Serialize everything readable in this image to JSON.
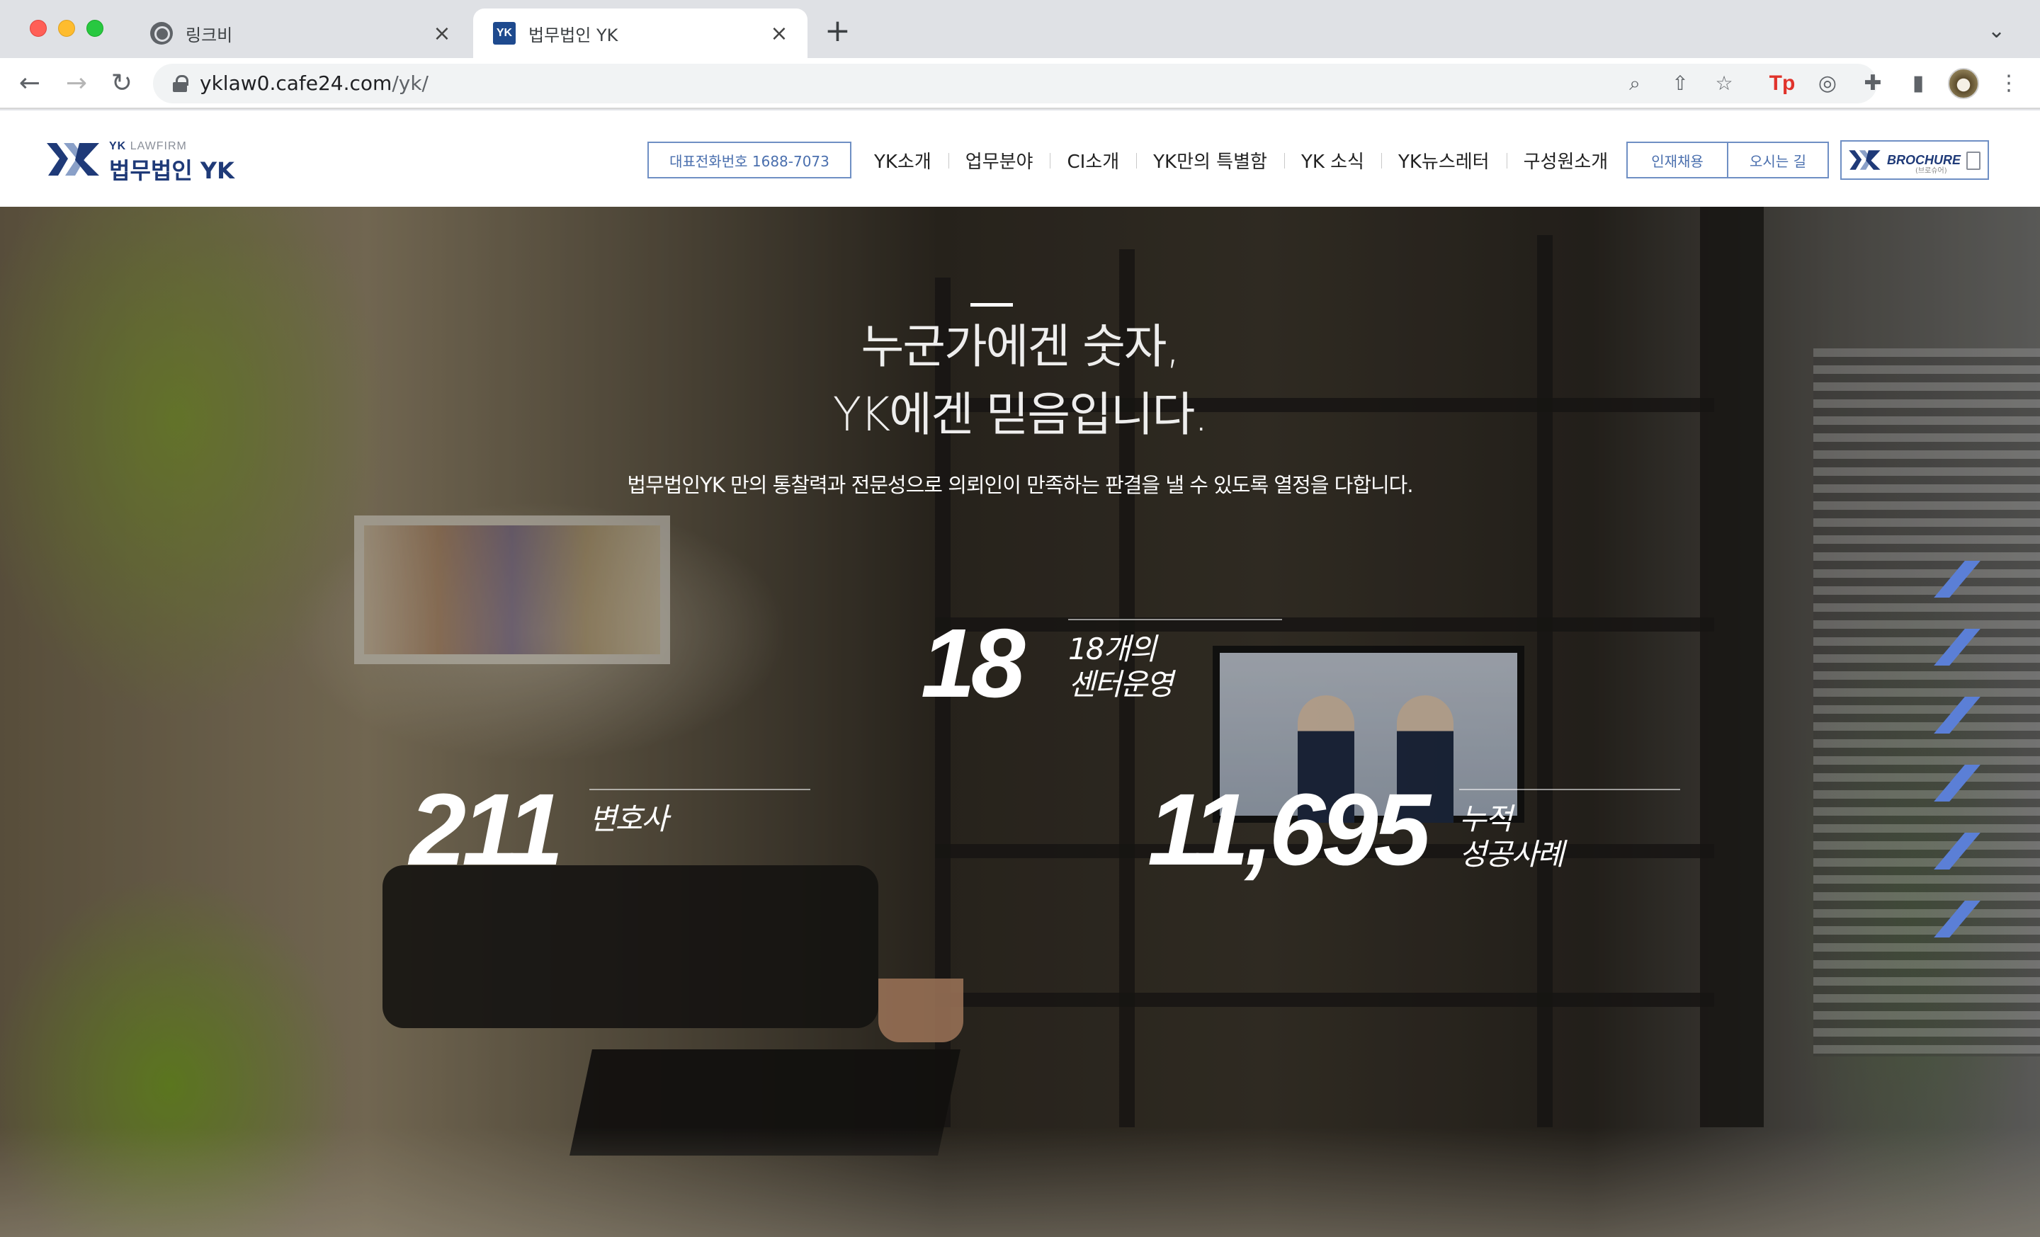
{
  "browser": {
    "tabs": [
      {
        "title": "링크비",
        "icon": "globe-icon"
      },
      {
        "title": "법무법인 YK",
        "icon": "yk-favicon"
      }
    ],
    "url_host": "yklaw0.cafe24.com",
    "url_path": "/yk/",
    "new_tab_glyph": "+",
    "tab_menu_glyph": "⌄",
    "extension_tp": "Tp"
  },
  "site": {
    "logo": {
      "sub_prefix": "YK",
      "sub": "LAWFIRM",
      "main": "법무법인 YK"
    },
    "phone_button": "대표전화번호 1688-7073",
    "nav": [
      "YK소개",
      "업무분야",
      "CI소개",
      "YK만의 특별함",
      "YK 소식",
      "YK뉴스레터",
      "구성원소개"
    ],
    "util": [
      "인재채용",
      "오시는 길"
    ],
    "brochure": {
      "label": "BROCHURE",
      "sub": "(브로슈어)"
    }
  },
  "hero": {
    "title_line1": "누군가에겐 숫자,",
    "title_line2": "YK에겐 믿음입니다.",
    "subtitle": "법무법인YK 만의 통찰력과 전문성으로 의뢰인이 만족하는 판결을 낼 수 있도록 열정을 다합니다.",
    "stats": [
      {
        "value": "18",
        "label_line1": "18개의",
        "label_line2": "센터운영"
      },
      {
        "value": "211",
        "label_line1": "변호사",
        "label_line2": ""
      },
      {
        "value": "11,695",
        "label_line1": "누적",
        "label_line2": "성공사례"
      }
    ]
  },
  "colors": {
    "brand_navy": "#1f3a78",
    "accent_blue": "#5b7fd6",
    "button_border": "#6f8fc4"
  }
}
